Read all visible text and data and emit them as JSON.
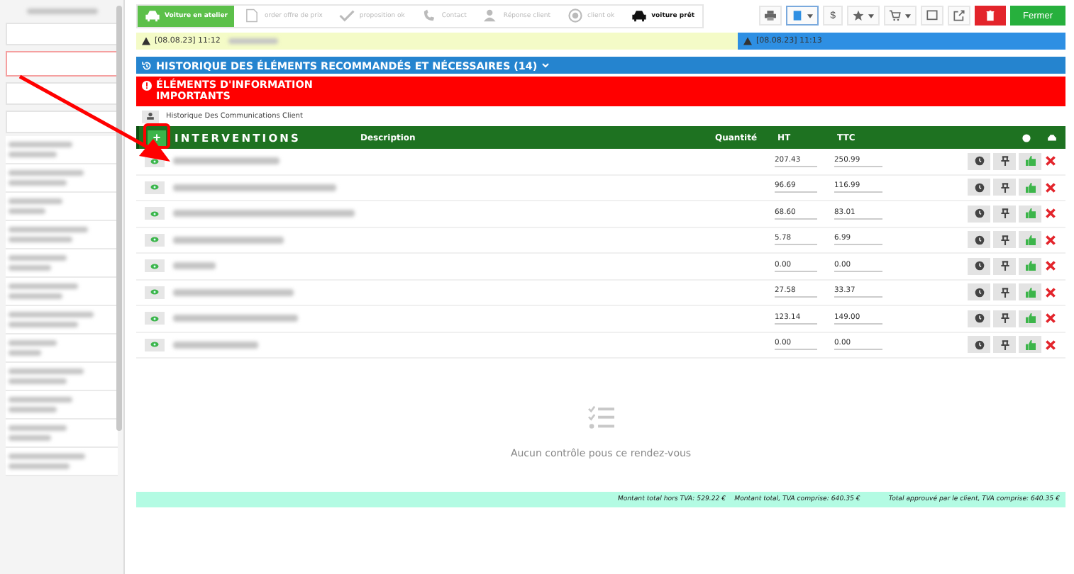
{
  "steps": [
    {
      "label": "Voiture en atelier",
      "kind": "done"
    },
    {
      "label": "order offre de prix",
      "kind": "pending"
    },
    {
      "label": "proposition ok",
      "kind": "pending"
    },
    {
      "label": "Contact",
      "kind": "pending"
    },
    {
      "label": "Réponse client",
      "kind": "pending"
    },
    {
      "label": "client ok",
      "kind": "pending"
    },
    {
      "label": "voiture prêt",
      "kind": "current"
    }
  ],
  "toolbar": [
    {
      "kind": "print"
    },
    {
      "kind": "doc",
      "selected": true,
      "caret": true
    },
    {
      "kind": "dollar",
      "label": "$"
    },
    {
      "kind": "star",
      "caret": true
    },
    {
      "kind": "cart",
      "caret": true
    },
    {
      "kind": "tablet"
    },
    {
      "kind": "export"
    },
    {
      "kind": "trash"
    },
    {
      "kind": "close",
      "label": "Fermer"
    }
  ],
  "notes": [
    {
      "text": "[08.08.23] 11:12",
      "color": "#f4fbc7"
    },
    {
      "text": "[08.08.23] 11:13",
      "color": "#2e8fe3"
    }
  ],
  "history": {
    "title": "HISTORIQUE DES ÉLÉMENTS RECOMMANDÉS ET NÉCESSAIRES (14)",
    "expanded": false
  },
  "important": {
    "title": "ÉLÉMENTS D'INFORMATION IMPORTANTS"
  },
  "communications": {
    "label": "Historique Des Communications Client"
  },
  "table": {
    "add": "+",
    "title": "INTERVENTIONS",
    "columns": [
      "Description",
      "Quantité",
      "HT",
      "TTC"
    ],
    "rows": [
      {
        "ht": "207.43",
        "ttc": "250.99"
      },
      {
        "ht": "96.69",
        "ttc": "116.99"
      },
      {
        "ht": "68.60",
        "ttc": "83.01"
      },
      {
        "ht": "5.78",
        "ttc": "6.99"
      },
      {
        "ht": "0.00",
        "ttc": "0.00"
      },
      {
        "ht": "27.58",
        "ttc": "33.37"
      },
      {
        "ht": "123.14",
        "ttc": "149.00"
      },
      {
        "ht": "0.00",
        "ttc": "0.00"
      }
    ]
  },
  "empty": {
    "message": "Aucun contrôle pous ce rendez-vous"
  },
  "totals": [
    "Montant total hors TVA: 529.22 €",
    "Montant total, TVA comprise: 640.35 €",
    "Total approuvé par le client, TVA comprise: 640.35 €"
  ]
}
